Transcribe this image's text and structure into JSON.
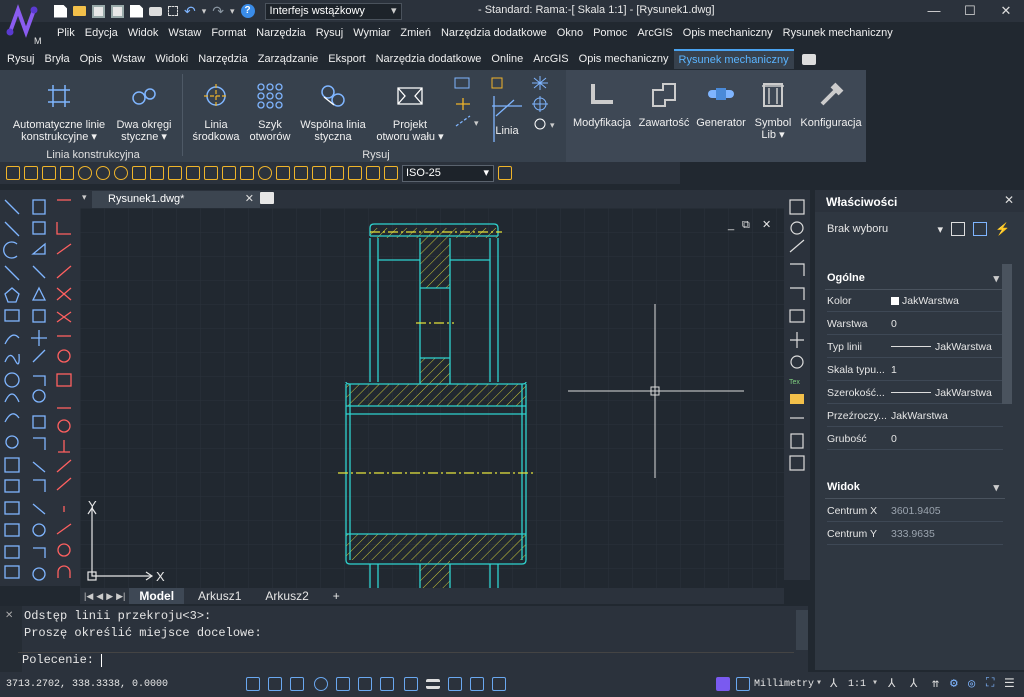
{
  "app": {
    "workspace": "Interfejs wstążkowy",
    "doc_title": "-  Standard: Rama:-[ Skala 1:1] - [Rysunek1.dwg]",
    "window_buttons": [
      "—",
      "☐",
      "✕"
    ]
  },
  "menu": [
    "Plik",
    "Edycja",
    "Widok",
    "Wstaw",
    "Format",
    "Narzędzia",
    "Rysuj",
    "Wymiar",
    "Zmień",
    "Narzędzia dodatkowe",
    "Okno",
    "Pomoc",
    "ArcGIS",
    "Opis mechaniczny",
    "Rysunek mechaniczny"
  ],
  "ribbon_tabs": [
    "Rysuj",
    "Bryła",
    "Opis",
    "Wstaw",
    "Widoki",
    "Narzędzia",
    "Zarządzanie",
    "Eksport",
    "Narzędzia dodatkowe",
    "Online",
    "ArcGIS",
    "Opis mechaniczny",
    "Rysunek mechaniczny"
  ],
  "ribbon_active_tab": "Rysunek mechaniczny",
  "ribbon": {
    "auto_lines_1": "Automatyczne linie",
    "auto_lines_2": "konstrukcyjne ▾",
    "two_circles_1": "Dwa okręgi",
    "two_circles_2": "styczne ▾",
    "center_line_1": "Linia",
    "center_line_2": "środkowa",
    "hole_pattern_1": "Szyk",
    "hole_pattern_2": "otworów",
    "common_tangent_1": "Wspólna linia",
    "common_tangent_2": "styczna",
    "shaft_hole_1": "Projekt",
    "shaft_hole_2": "otworu wału ▾",
    "line": "Linia",
    "modify": "Modyfikacja",
    "content": "Zawartość",
    "generator": "Generator",
    "symbol_1": "Symbol",
    "symbol_2": "Lib ▾",
    "config": "Konfiguracja",
    "group_construction": "Linia konstrukcyjna",
    "group_draw": "Rysuj"
  },
  "toolbar": {
    "dim_style": "ISO-25"
  },
  "drawing": {
    "tab_name": "Rysunek1.dwg*",
    "axis_x": "X",
    "axis_y": "Y",
    "view_buttons": [
      "_",
      "⧉",
      "✕"
    ]
  },
  "layout_tabs": [
    "Model",
    "Arkusz1",
    "Arkusz2",
    "+"
  ],
  "properties": {
    "title": "Właściwości",
    "selection": "Brak wyboru",
    "general": "Ogólne",
    "view": "Widok",
    "rows": [
      {
        "k": "Kolor",
        "v": "JakWarstwa"
      },
      {
        "k": "Warstwa",
        "v": "0"
      },
      {
        "k": "Typ linii",
        "v": "JakWarstwa"
      },
      {
        "k": "Skala typu...",
        "v": "1"
      },
      {
        "k": "Szerokość...",
        "v": "JakWarstwa"
      },
      {
        "k": "Przeźroczy...",
        "v": "JakWarstwa"
      },
      {
        "k": "Grubość",
        "v": "0"
      }
    ],
    "view_rows": [
      {
        "k": "Centrum X",
        "v": "3601.9405"
      },
      {
        "k": "Centrum Y",
        "v": "333.9635"
      }
    ]
  },
  "command": {
    "line1": "Odstęp linii przekroju<3>:",
    "line2": "Proszę określić miejsce docelowe:",
    "prompt": "Polecenie: "
  },
  "status": {
    "coords": "3713.2702, 338.3338, 0.0000",
    "units": "Millimetry",
    "scale": "1:1"
  },
  "colors": {
    "accent": "#4aa3f0",
    "geometry": "#2fd3cf",
    "centerline": "#e4e23a",
    "hatch": "#c8c63a"
  }
}
